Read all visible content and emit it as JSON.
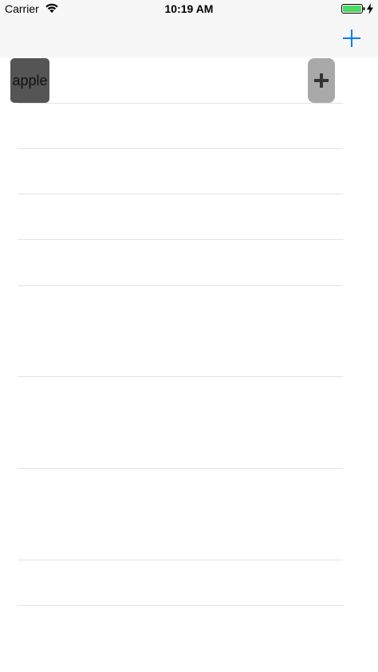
{
  "status_bar": {
    "carrier": "Carrier",
    "time": "10:19 AM",
    "wifi_icon": "wifi-icon",
    "battery_icon": "battery-icon",
    "battery_color": "#4cd964",
    "charging_icon": "charging-bolt-icon"
  },
  "nav_bar": {
    "add_icon": "plus-icon",
    "tint_color": "#007aff"
  },
  "table": {
    "rows": [
      {
        "label": "apple",
        "tile_color": "#555555",
        "button_icon": "plus-icon",
        "button_color": "#a9a9a9"
      }
    ]
  }
}
